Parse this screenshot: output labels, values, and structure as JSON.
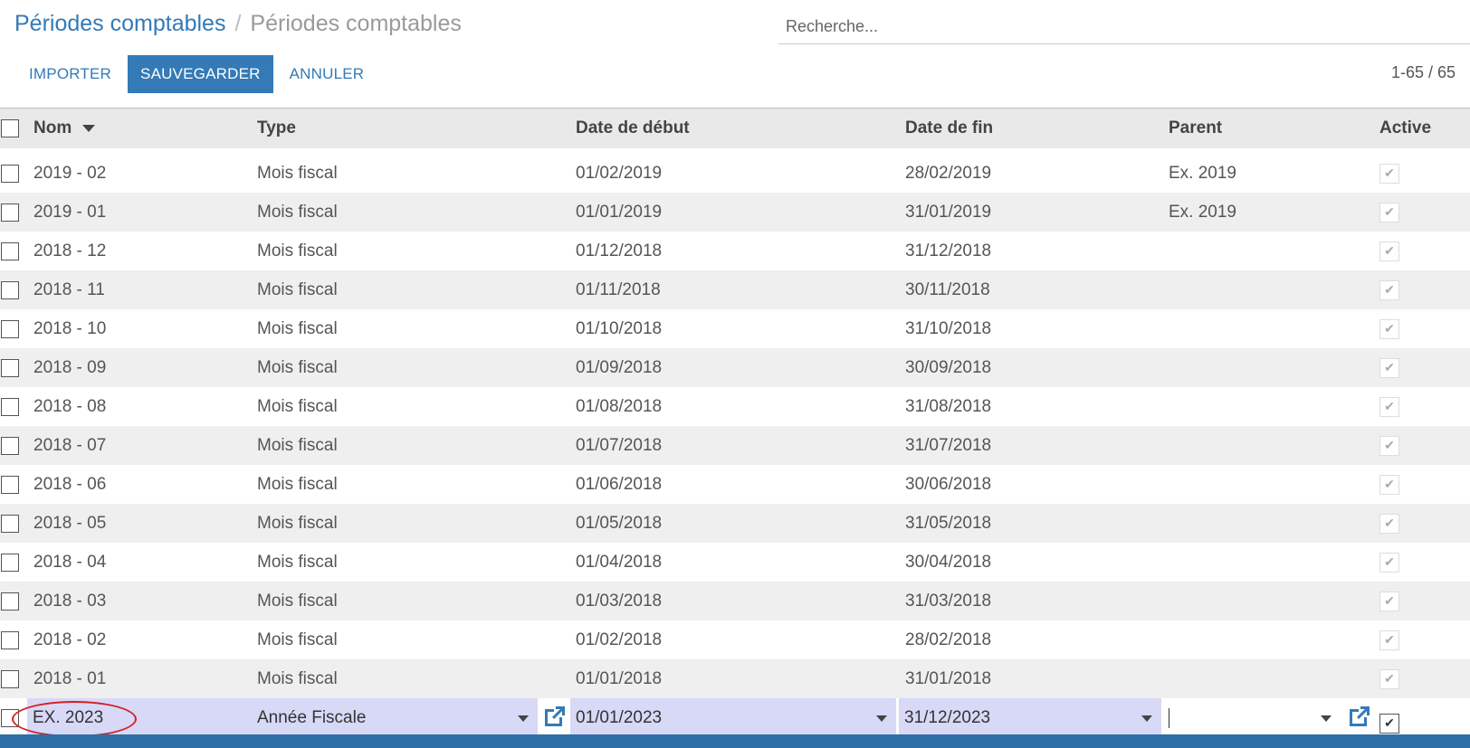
{
  "breadcrumb": {
    "parent": "Périodes comptables",
    "current": "Périodes comptables"
  },
  "search": {
    "placeholder": "Recherche..."
  },
  "toolbar": {
    "import_label": "IMPORTER",
    "save_label": "SAUVEGARDER",
    "cancel_label": "ANNULER"
  },
  "pager": {
    "text": "1-65 / 65"
  },
  "table": {
    "headers": {
      "nom": "Nom",
      "type": "Type",
      "debut": "Date de début",
      "fin": "Date de fin",
      "parent": "Parent",
      "active": "Active"
    },
    "rows": [
      {
        "nom": "2019 - 02",
        "type": "Mois fiscal",
        "debut": "01/02/2019",
        "fin": "28/02/2019",
        "parent": "Ex. 2019",
        "active": true
      },
      {
        "nom": "2019 - 01",
        "type": "Mois fiscal",
        "debut": "01/01/2019",
        "fin": "31/01/2019",
        "parent": "Ex. 2019",
        "active": true
      },
      {
        "nom": "2018 - 12",
        "type": "Mois fiscal",
        "debut": "01/12/2018",
        "fin": "31/12/2018",
        "parent": "",
        "active": true
      },
      {
        "nom": "2018 - 11",
        "type": "Mois fiscal",
        "debut": "01/11/2018",
        "fin": "30/11/2018",
        "parent": "",
        "active": true
      },
      {
        "nom": "2018 - 10",
        "type": "Mois fiscal",
        "debut": "01/10/2018",
        "fin": "31/10/2018",
        "parent": "",
        "active": true
      },
      {
        "nom": "2018 - 09",
        "type": "Mois fiscal",
        "debut": "01/09/2018",
        "fin": "30/09/2018",
        "parent": "",
        "active": true
      },
      {
        "nom": "2018 - 08",
        "type": "Mois fiscal",
        "debut": "01/08/2018",
        "fin": "31/08/2018",
        "parent": "",
        "active": true
      },
      {
        "nom": "2018 - 07",
        "type": "Mois fiscal",
        "debut": "01/07/2018",
        "fin": "31/07/2018",
        "parent": "",
        "active": true
      },
      {
        "nom": "2018 - 06",
        "type": "Mois fiscal",
        "debut": "01/06/2018",
        "fin": "30/06/2018",
        "parent": "",
        "active": true
      },
      {
        "nom": "2018 - 05",
        "type": "Mois fiscal",
        "debut": "01/05/2018",
        "fin": "31/05/2018",
        "parent": "",
        "active": true
      },
      {
        "nom": "2018 - 04",
        "type": "Mois fiscal",
        "debut": "01/04/2018",
        "fin": "30/04/2018",
        "parent": "",
        "active": true
      },
      {
        "nom": "2018 - 03",
        "type": "Mois fiscal",
        "debut": "01/03/2018",
        "fin": "31/03/2018",
        "parent": "",
        "active": true
      },
      {
        "nom": "2018 - 02",
        "type": "Mois fiscal",
        "debut": "01/02/2018",
        "fin": "28/02/2018",
        "parent": "",
        "active": true
      },
      {
        "nom": "2018 - 01",
        "type": "Mois fiscal",
        "debut": "01/01/2018",
        "fin": "31/01/2018",
        "parent": "",
        "active": true
      }
    ],
    "edit_row": {
      "nom": "EX. 2023",
      "type": "Année Fiscale",
      "debut": "01/01/2023",
      "fin": "31/12/2023",
      "parent": "",
      "active": true
    }
  },
  "icons": {
    "sort": "caret-down-icon",
    "external": "external-link-icon",
    "check": "checkmark-icon"
  },
  "colors": {
    "link": "#337ab7",
    "edit_bg": "#d8d8f7",
    "annotation": "#d32020",
    "stripe": "#efefef"
  }
}
